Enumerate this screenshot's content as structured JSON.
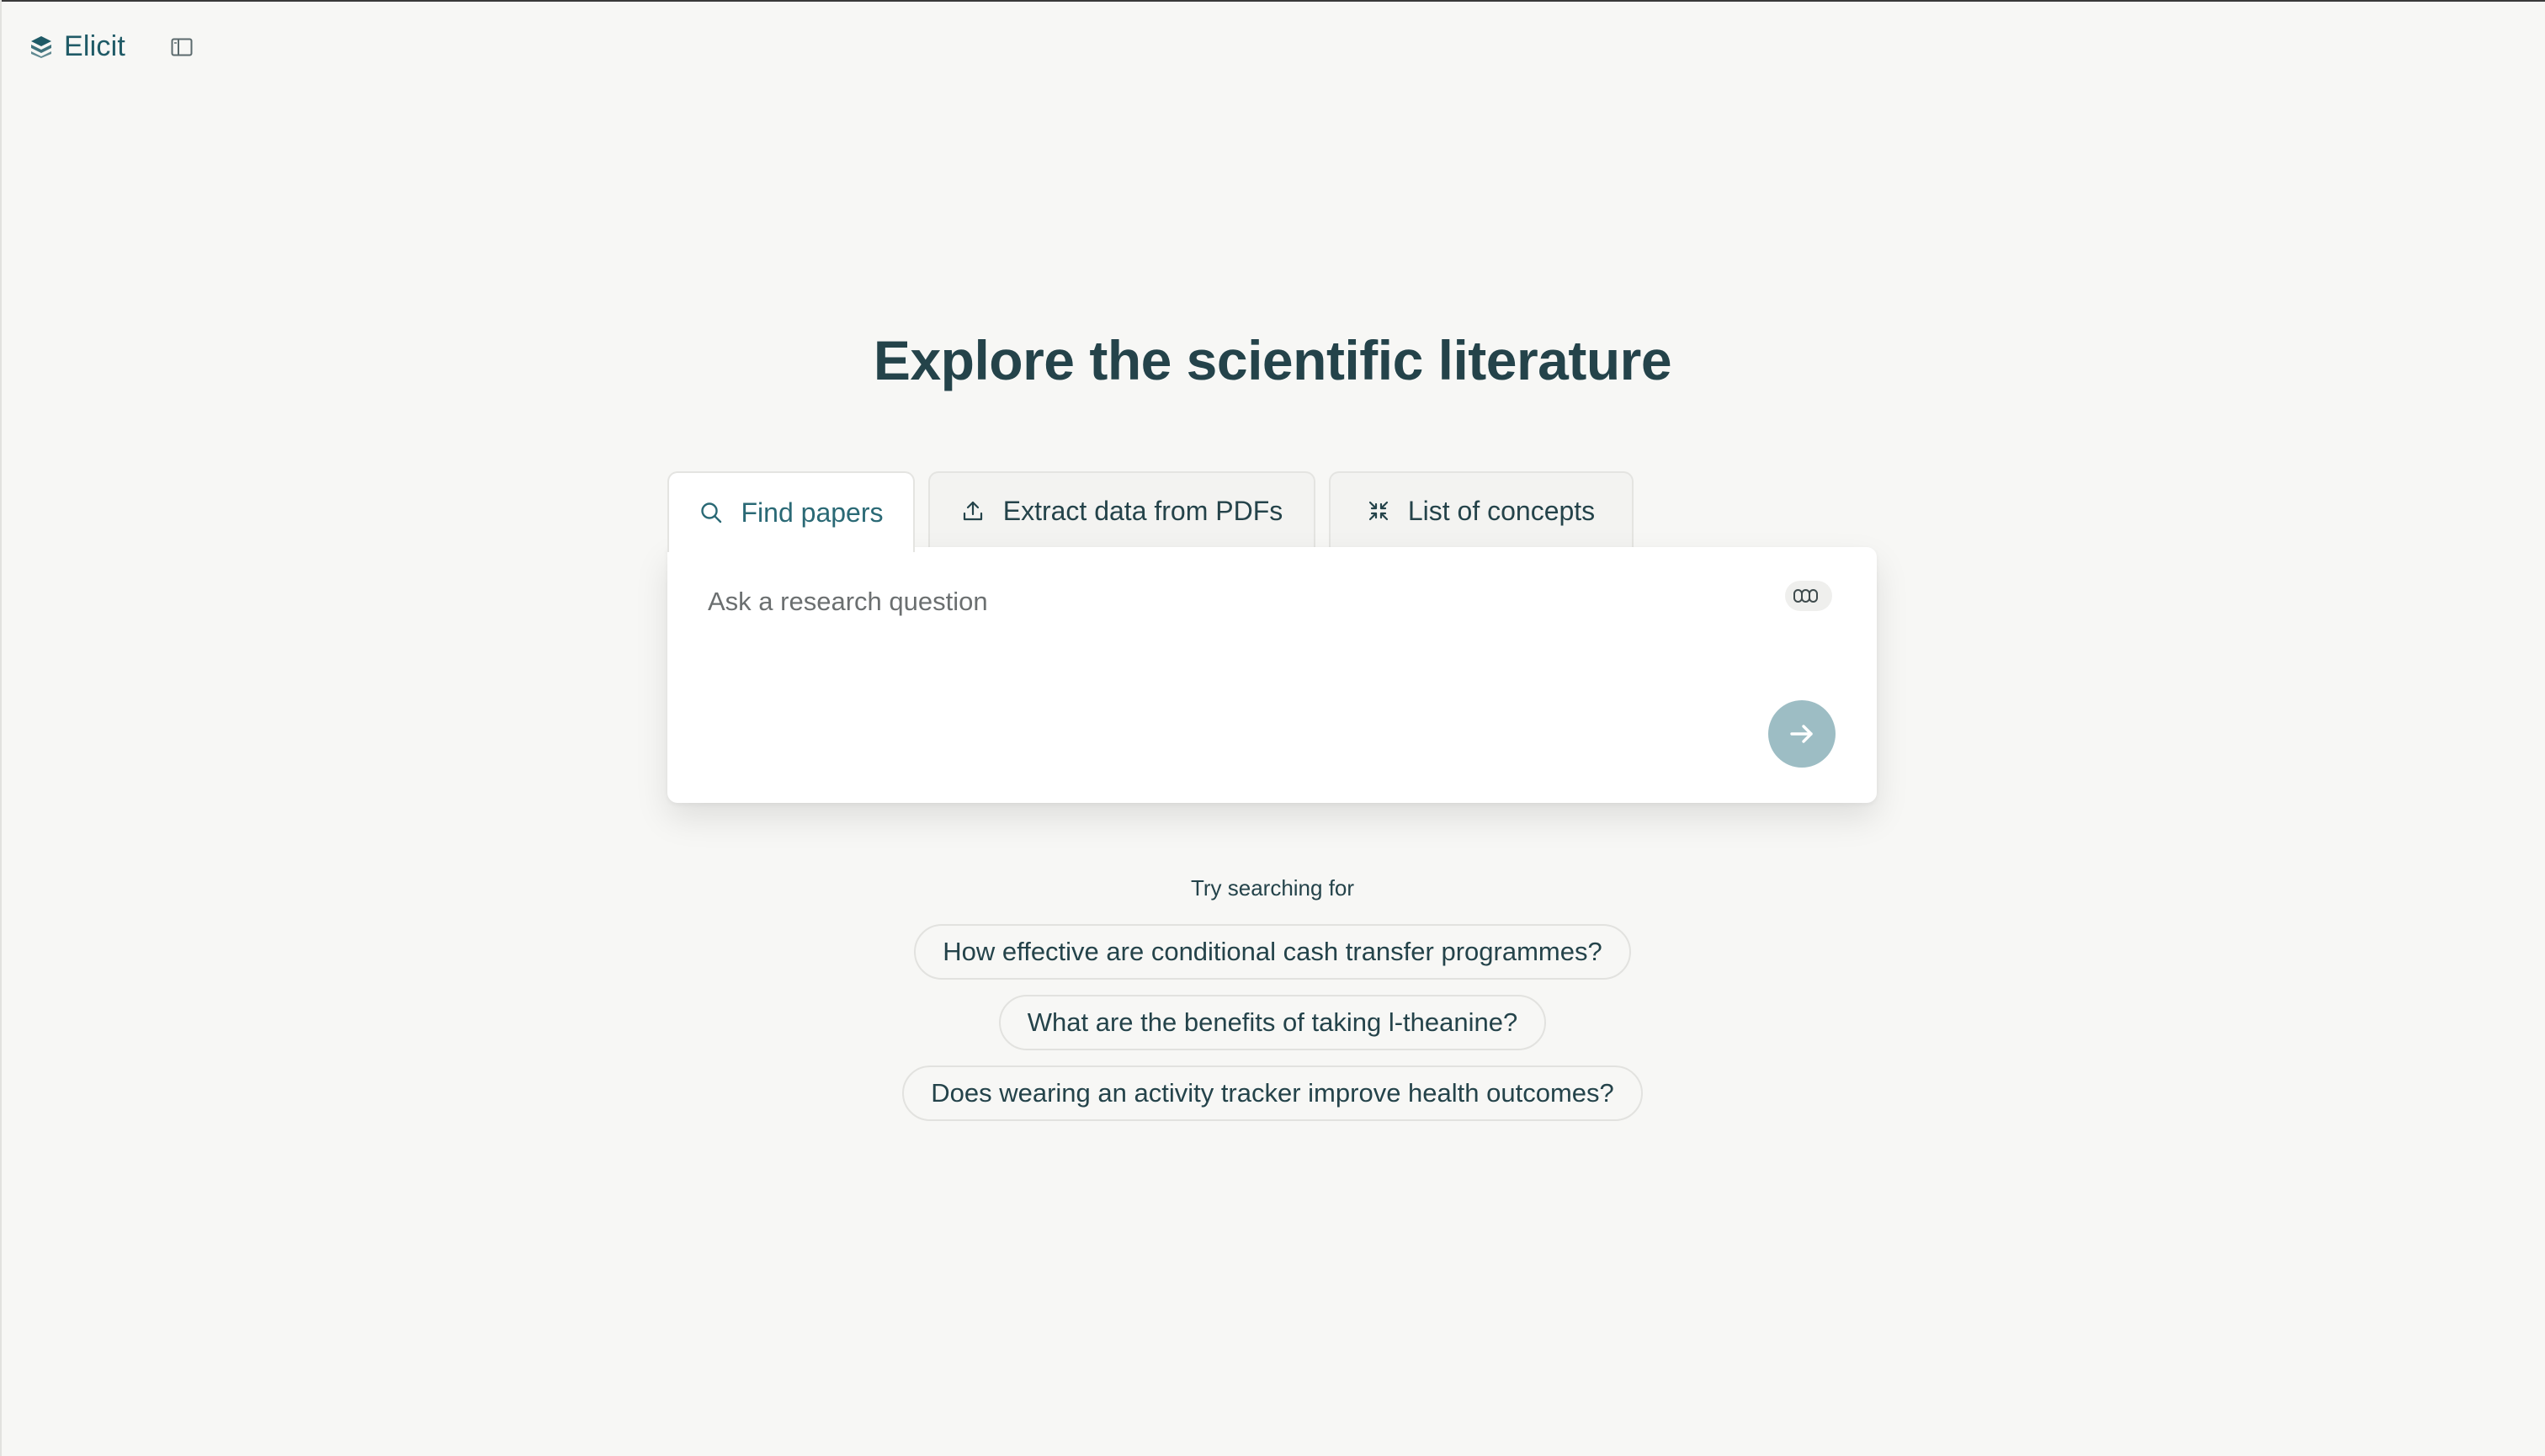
{
  "brand": {
    "name": "Elicit"
  },
  "headline": "Explore the scientific literature",
  "tabs": [
    {
      "label": "Find papers",
      "icon": "search-icon",
      "active": true
    },
    {
      "label": "Extract data from PDFs",
      "icon": "upload-icon",
      "active": false
    },
    {
      "label": "List of concepts",
      "icon": "collapse-arrows-icon",
      "active": false
    }
  ],
  "search": {
    "placeholder": "Ask a research question",
    "value": ""
  },
  "suggestions": {
    "label": "Try searching for",
    "items": [
      "How effective are conditional cash transfer programmes?",
      "What are the benefits of taking l-theanine?",
      "Does wearing an activity tracker improve health outcomes?"
    ]
  },
  "colors": {
    "background": "#f7f7f5",
    "brand": "#1f5a66",
    "heading": "#24434a",
    "active_tab_text": "#2a6975",
    "submit_button": "#9dbdc4"
  }
}
